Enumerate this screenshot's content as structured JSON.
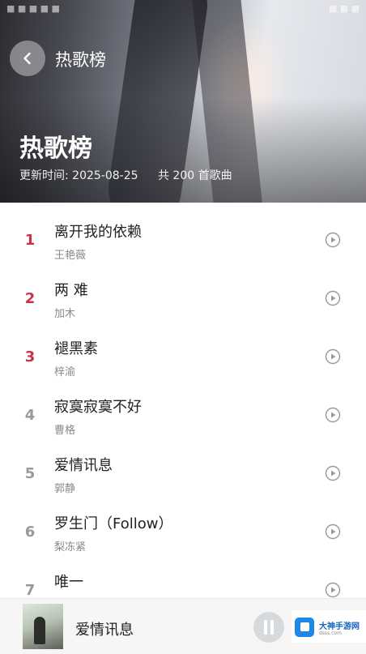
{
  "statusbar": {
    "left": "■ ■ ■  ■ ■",
    "right": "■ ■ ■"
  },
  "header": {
    "nav_title": "热歌榜",
    "title": "热歌榜",
    "update_time": "更新时间: 2025-08-25",
    "song_count": "共 200 首歌曲"
  },
  "songs": [
    {
      "rank": "1",
      "title": "离开我的依赖",
      "artist": "王艳薇"
    },
    {
      "rank": "2",
      "title": "两 难",
      "artist": "加木"
    },
    {
      "rank": "3",
      "title": "褪黑素",
      "artist": "梓渝"
    },
    {
      "rank": "4",
      "title": "寂寞寂寞不好",
      "artist": "曹格"
    },
    {
      "rank": "5",
      "title": "爱情讯息",
      "artist": "郭静"
    },
    {
      "rank": "6",
      "title": "罗生门（Follow）",
      "artist": "梨冻紧"
    },
    {
      "rank": "7",
      "title": "唯一",
      "artist": ""
    }
  ],
  "player": {
    "now_playing": "爱情讯息"
  },
  "watermark": {
    "name": "大神手游网",
    "domain": "dsss.com"
  },
  "colors": {
    "rank_top": "#c8344a",
    "rank_normal": "#999999"
  },
  "icons": {
    "back": "chevron-left-icon",
    "play": "play-circle-icon",
    "pause": "pause-icon"
  }
}
